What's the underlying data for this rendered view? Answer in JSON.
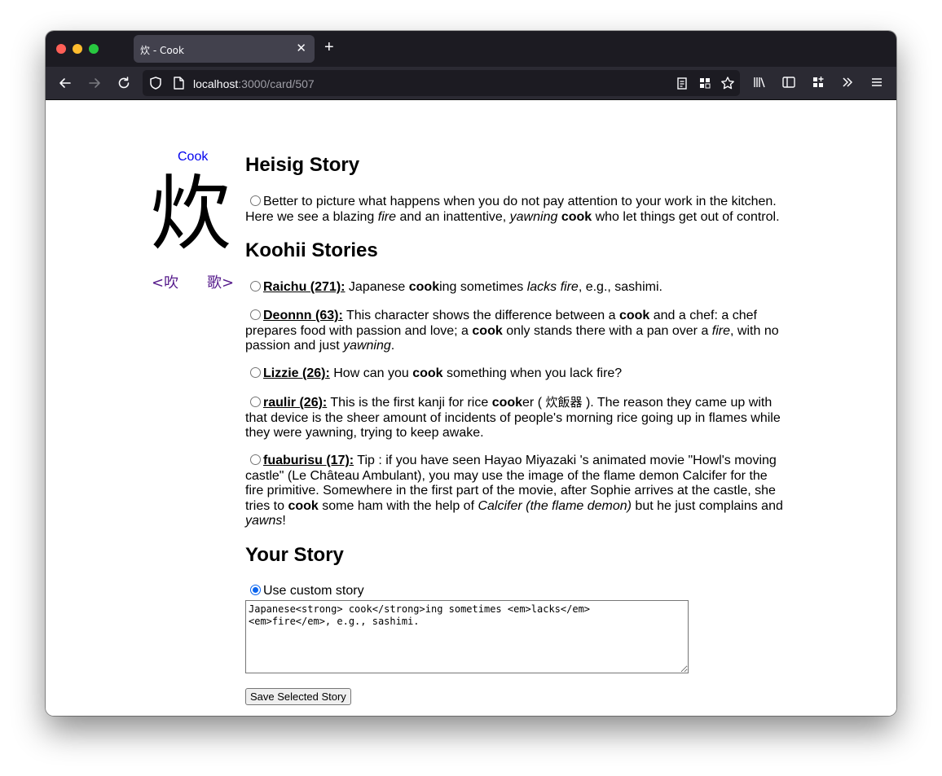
{
  "browser": {
    "tab_title": "炊 - Cook",
    "url_host": "localhost",
    "url_path": ":3000/card/507"
  },
  "card": {
    "keyword": "Cook",
    "kanji": "炊",
    "prev": "<吹",
    "next": "歌>"
  },
  "heisig": {
    "heading": "Heisig Story",
    "text_parts": [
      "Better to picture what happens when you do not pay attention to your work in the kitchen. Here we see a blazing ",
      "fire",
      " and an inattentive, ",
      "yawning",
      " ",
      "cook",
      " who let things get out of control."
    ]
  },
  "koohii": {
    "heading": "Koohii Stories",
    "stories": [
      {
        "author": "Raichu (271):",
        "parts": [
          " Japanese ",
          "cook",
          "ing sometimes ",
          "lacks fire",
          ", e.g., sashimi."
        ]
      },
      {
        "author": "Deonnn (63):",
        "parts": [
          " This character shows the difference between a ",
          "cook",
          " and a chef: a chef prepares food with passion and love; a ",
          "cook",
          " only stands there with a pan over a ",
          "fire",
          ", with no passion and just ",
          "yawning",
          "."
        ]
      },
      {
        "author": "Lizzie (26):",
        "parts": [
          " How can you ",
          "cook",
          " something when you lack fire?"
        ]
      },
      {
        "author": "raulir (26):",
        "parts": [
          " This is the first kanji for rice ",
          "cook",
          "er ( ",
          "炊飯器",
          " ). The reason they came up with that device is the sheer amount of incidents of people's morning rice going up in flames while they were yawning, trying to keep awake."
        ]
      },
      {
        "author": "fuaburisu (17):",
        "parts": [
          " Tip : if you have seen Hayao Miyazaki 's animated movie \"Howl's moving castle\" (Le Château Ambulant), you may use the image of the flame demon Calcifer for the fire primitive. Somewhere in the first part of the movie, after Sophie arrives at the castle, she tries to ",
          "cook",
          " some ham with the help of ",
          "Calcifer (the flame demon)",
          " but he just complains and ",
          "yawns",
          "!"
        ]
      }
    ]
  },
  "your_story": {
    "heading": "Your Story",
    "radio_label": "Use custom story",
    "textarea_value": "Japanese<strong> cook</strong>ing sometimes <em>lacks</em>\n<em>fire</em>, e.g., sashimi.",
    "save_label": "Save Selected Story"
  }
}
